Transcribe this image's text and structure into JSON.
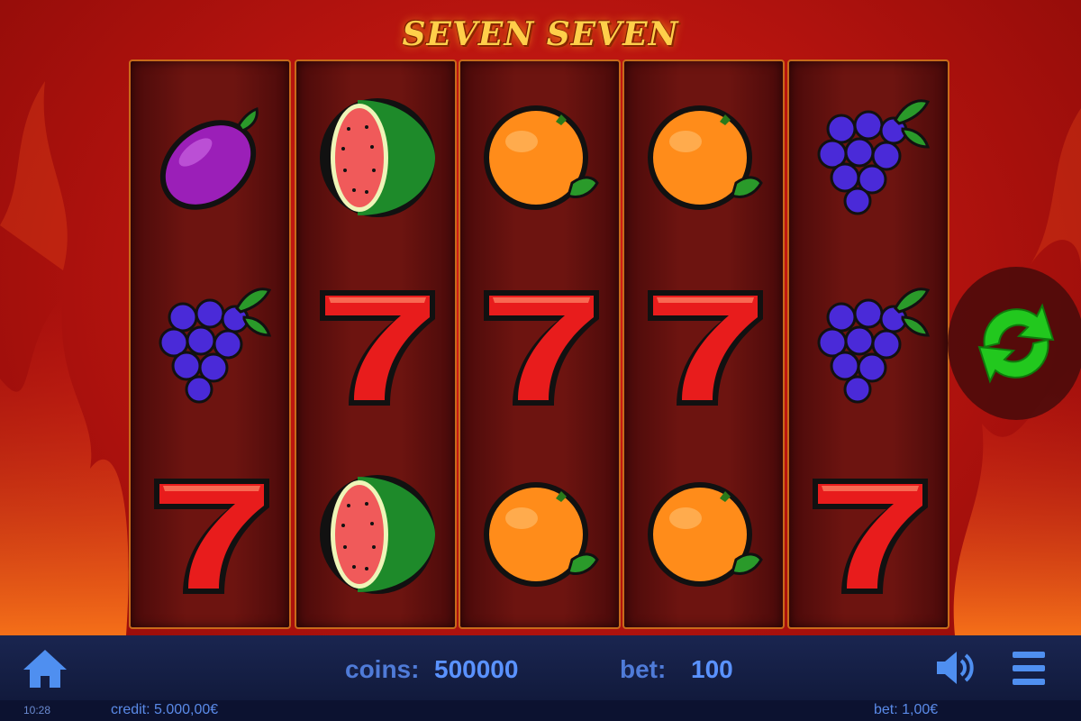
{
  "game": {
    "title": "SEVEN SEVEN"
  },
  "reels": [
    [
      "plum",
      "grapes",
      "seven"
    ],
    [
      "watermelon",
      "seven",
      "watermelon"
    ],
    [
      "orange",
      "seven",
      "orange"
    ],
    [
      "orange",
      "seven",
      "orange"
    ],
    [
      "grapes",
      "grapes",
      "seven"
    ]
  ],
  "controls": {
    "spin_icon": "refresh-arrows-icon",
    "home_icon": "home-icon",
    "sound_icon": "speaker-icon",
    "menu_icon": "hamburger-menu-icon"
  },
  "bar": {
    "coins_label": "coins:",
    "coins_value": "500000",
    "bet_label": "bet:",
    "bet_value": "100"
  },
  "status": {
    "clock": "10:28",
    "credit": "credit: 5.000,00€",
    "bet": "bet: 1,00€"
  },
  "colors": {
    "spin_green": "#22c81e",
    "bar_blue": "#4f7bd8"
  }
}
